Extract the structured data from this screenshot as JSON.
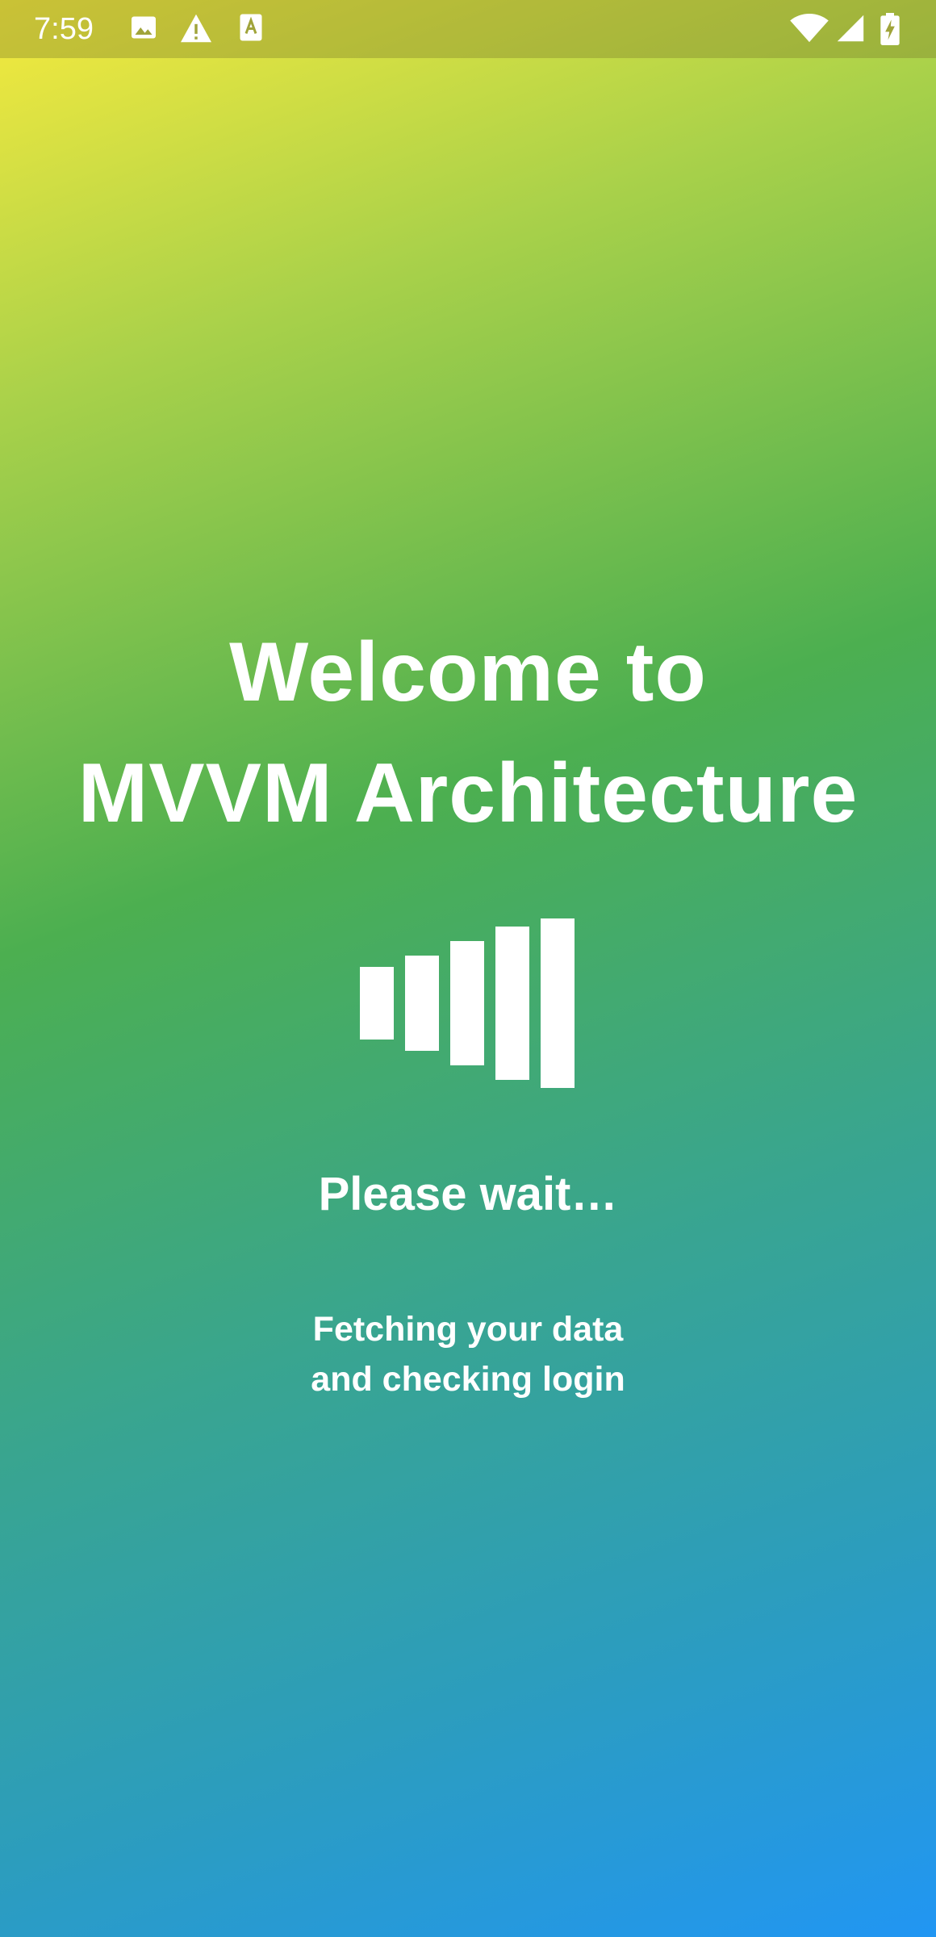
{
  "status_bar": {
    "time": "7:59",
    "left_icons": [
      "image-icon",
      "warning-icon",
      "text-a-icon"
    ],
    "right_icons": [
      "wifi-icon",
      "signal-icon",
      "battery-charging-icon"
    ]
  },
  "splash": {
    "welcome_line1": "Welcome to",
    "welcome_line2": "MVVM Architecture",
    "loader_icon": "loading-bars-icon",
    "please_wait": "Please wait…",
    "fetching_line1": "Fetching your data",
    "fetching_line2": "and checking login"
  },
  "colors": {
    "gradient_start": "#f6ea3e",
    "gradient_mid": "#4caf50",
    "gradient_end": "#2196f3",
    "text": "#ffffff"
  }
}
